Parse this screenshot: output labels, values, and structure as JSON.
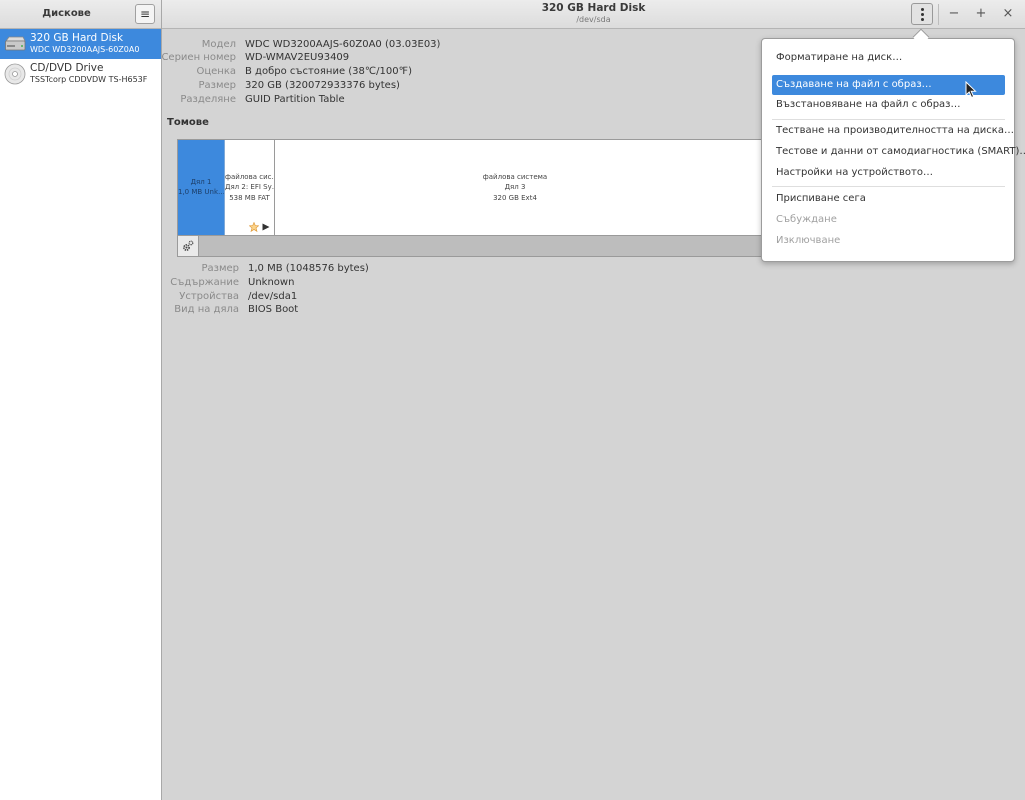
{
  "sidebar": {
    "title": "Дискове",
    "menu_icon": "hamburger-icon",
    "disks": [
      {
        "name": "320 GB Hard Disk",
        "model": "WDC WD3200AAJS-60Z0A0",
        "icon": "hard-disk-icon"
      },
      {
        "name": "CD/DVD Drive",
        "model": "TSSTcorp CDDVDW TS-H653F",
        "icon": "optical-disc-icon"
      }
    ]
  },
  "header": {
    "title": "320 GB Hard Disk",
    "subtitle": "/dev/sda",
    "kebab_icon": "kebab-menu-icon",
    "minimize": "−",
    "maximize": "+",
    "close": "×"
  },
  "disk_info": {
    "model_label": "Модел",
    "model_value": "WDC WD3200AAJS-60Z0A0 (03.03E03)",
    "serial_label": "Сериен номер",
    "serial_value": "WD-WMAV2EU93409",
    "assessment_label": "Оценка",
    "assessment_value": "В добро състояние (38℃/100℉)",
    "size_label": "Размер",
    "size_value": "320 GB (320072933376 bytes)",
    "partitioning_label": "Разделяне",
    "partitioning_value": "GUID Partition Table"
  },
  "volumes": {
    "title": "Томове",
    "partitions": [
      {
        "line1": "Дял 1",
        "line2": "1,0 MB Unk…"
      },
      {
        "line1": "файлова сис…",
        "line2": "Дял 2: EFI Sy…",
        "line3": "538 MB FAT"
      },
      {
        "line1": "файлова система",
        "line2": "Дял 3",
        "line3": "320 GB Ext4"
      }
    ]
  },
  "partition_info": {
    "size_label": "Размер",
    "size_value": "1,0 MB (1048576 bytes)",
    "contents_label": "Съдържание",
    "contents_value": "Unknown",
    "device_label": "Устройства",
    "device_value": "/dev/sda1",
    "type_label": "Вид на дяла",
    "type_value": "BIOS Boot"
  },
  "menu": {
    "format": "Форматиране на диск…",
    "create_image": "Създаване на файл с образ…",
    "restore_image": "Възстановяване на файл с образ…",
    "benchmark": "Тестване на производителността на диска…",
    "smart": "Тестове и данни от самодиагностика (SMART)…",
    "settings": "Настройки на устройството…",
    "standby": "Приспиване сега",
    "wakeup": "Събуждане",
    "poweroff": "Изключване"
  },
  "colors": {
    "accent": "#3d89dd",
    "background": "#d4d4d4"
  }
}
